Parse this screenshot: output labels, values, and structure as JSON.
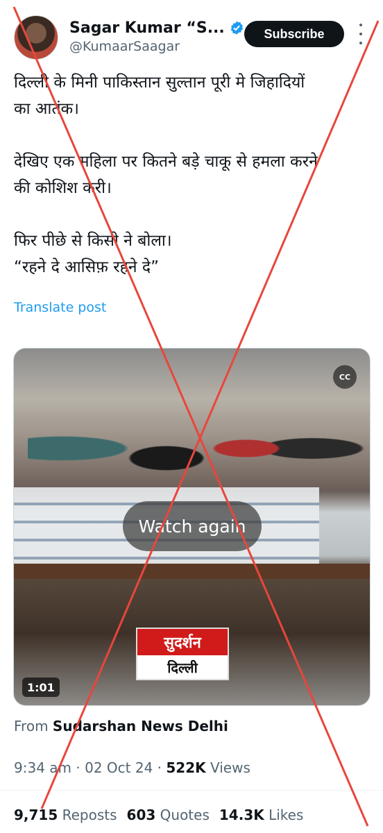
{
  "author": {
    "display_name": "Sagar Kumar “S...",
    "handle": "@KumaarSaagar",
    "verified_icon": "verified-badge-icon",
    "avatar": "avatar"
  },
  "header": {
    "subscribe_label": "Subscribe",
    "more_icon": "more-vertical-icon"
  },
  "post": {
    "lines": [
      "दिल्ली के मिनी पाकिस्तान सुल्तान पूरी मे जिहादियों",
      "का आतंक।",
      "देखिए एक महिला पर कितने बड़े चाकू से हमला करने",
      "की कोशिश करी।",
      "फिर पीछे से किसी ने बोला।",
      "“रहने दे आसिफ़ रहने दे”"
    ],
    "translate_label": "Translate post"
  },
  "media": {
    "cc_label": "CC",
    "watch_again_label": "Watch again",
    "logo_top": "सुदर्शन",
    "logo_bottom": "दिल्ली",
    "duration": "1:01"
  },
  "source": {
    "prefix": "From",
    "name": "Sudarshan News Delhi"
  },
  "meta": {
    "time": "9:34 am",
    "separator": "·",
    "date": "02 Oct 24",
    "views_count": "522K",
    "views_label": "Views"
  },
  "stats": {
    "reposts_count": "9,715",
    "reposts_label": "Reposts",
    "quotes_count": "603",
    "quotes_label": "Quotes",
    "likes_count": "14.3K",
    "likes_label": "Likes"
  },
  "colors": {
    "link": "#1d9bf0",
    "overlay_cross": "#e8463c",
    "muted": "#536471"
  }
}
